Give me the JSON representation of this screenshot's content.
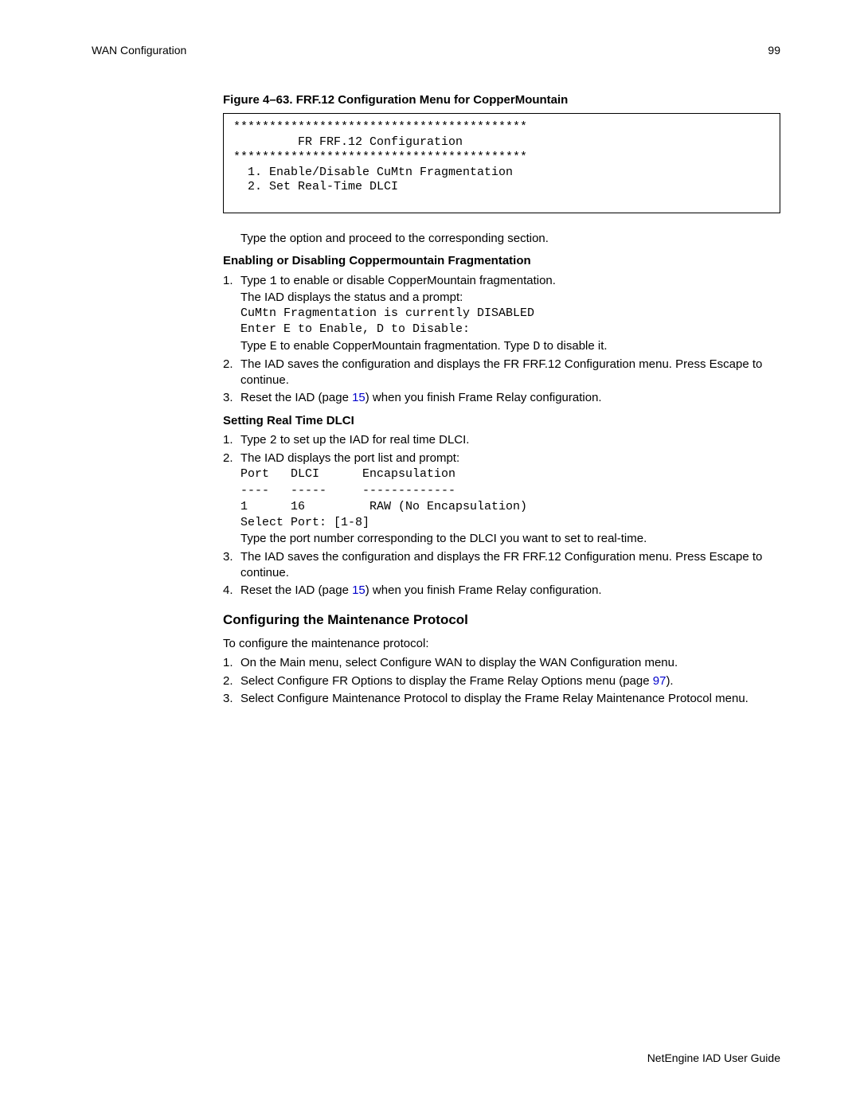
{
  "header": {
    "left": "WAN Configuration",
    "right": "99"
  },
  "figure": {
    "caption": "Figure 4–63.  FRF.12 Configuration Menu for CopperMountain",
    "box": "*****************************************\n         FR FRF.12 Configuration\n*****************************************\n  1. Enable/Disable CuMtn Fragmentation\n  2. Set Real-Time DLCI"
  },
  "intro_para": "Type the option and proceed to the corresponding section.",
  "sec1": {
    "heading": "Enabling or Disabling Coppermountain Fragmentation",
    "items": [
      {
        "num": "1.",
        "line1_a": "Type ",
        "line1_code": "1",
        "line1_b": " to enable or disable CopperMountain fragmentation.",
        "line2": "The IAD displays the status and a prompt:",
        "code_block": "CuMtn Fragmentation is currently DISABLED\nEnter E to Enable, D to Disable:",
        "line3_a": "Type ",
        "line3_code1": "E",
        "line3_b": " to enable CopperMountain fragmentation. Type ",
        "line3_code2": "D",
        "line3_c": " to disable it."
      },
      {
        "num": "2.",
        "text": "The IAD saves the configuration and displays the FR FRF.12 Configuration menu. Press Escape to continue."
      },
      {
        "num": "3.",
        "a": "Reset the IAD (page ",
        "link": "15",
        "b": ") when you finish Frame Relay configuration."
      }
    ]
  },
  "sec2": {
    "heading": "Setting Real Time DLCI",
    "items": [
      {
        "num": "1.",
        "a": "Type ",
        "code": "2",
        "b": " to set up the IAD for real time DLCI."
      },
      {
        "num": "2.",
        "line1": "The IAD displays the port list and prompt:",
        "code_block": "Port   DLCI      Encapsulation\n----   -----     -------------\n1      16         RAW (No Encapsulation)\nSelect Port: [1-8]",
        "line2": "Type the port number corresponding to the DLCI you want to set to real-time."
      },
      {
        "num": "3.",
        "text": "The IAD saves the configuration and displays the FR FRF.12 Configuration menu. Press Escape to continue."
      },
      {
        "num": "4.",
        "a": "Reset the IAD (page ",
        "link": "15",
        "b": ") when you finish Frame Relay configuration."
      }
    ]
  },
  "sec3": {
    "heading": "Configuring the Maintenance Protocol",
    "intro": "To configure the maintenance protocol:",
    "items": [
      {
        "num": "1.",
        "text": "On the Main menu, select Configure WAN to display the WAN Configuration menu."
      },
      {
        "num": "2.",
        "a": "Select Configure FR Options to display the Frame Relay Options menu (page ",
        "link": "97",
        "b": ")."
      },
      {
        "num": "3.",
        "text": "Select Configure Maintenance Protocol to display the Frame Relay Maintenance Protocol menu."
      }
    ]
  },
  "footer": "NetEngine IAD User Guide"
}
